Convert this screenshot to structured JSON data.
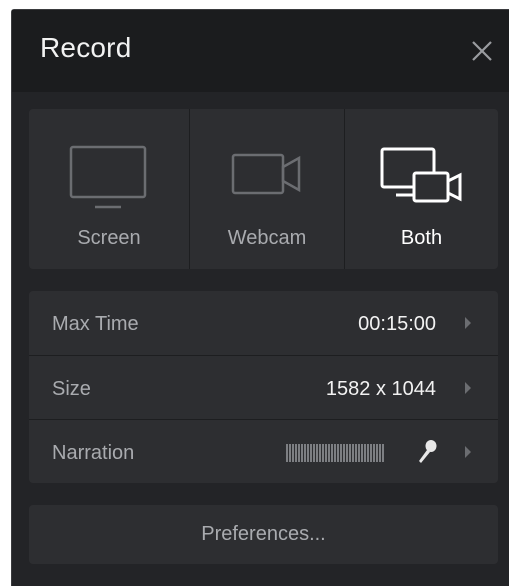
{
  "window": {
    "title": "Record"
  },
  "modes": [
    {
      "label": "Screen",
      "icon": "monitor-icon",
      "selected": false
    },
    {
      "label": "Webcam",
      "icon": "webcam-icon",
      "selected": false
    },
    {
      "label": "Both",
      "icon": "monitor-webcam-icon",
      "selected": true
    }
  ],
  "settings": {
    "max_time": {
      "label": "Max Time",
      "value": "00:15:00"
    },
    "size": {
      "label": "Size",
      "value": "1582 x 1044"
    },
    "narration": {
      "label": "Narration"
    }
  },
  "preferences_label": "Preferences...",
  "colors": {
    "panel_bg": "#232427",
    "titlebar_bg": "#1b1c1e",
    "card_bg": "#2d2e31",
    "text_primary": "#f2f2f2",
    "text_secondary": "#a9abaf"
  }
}
